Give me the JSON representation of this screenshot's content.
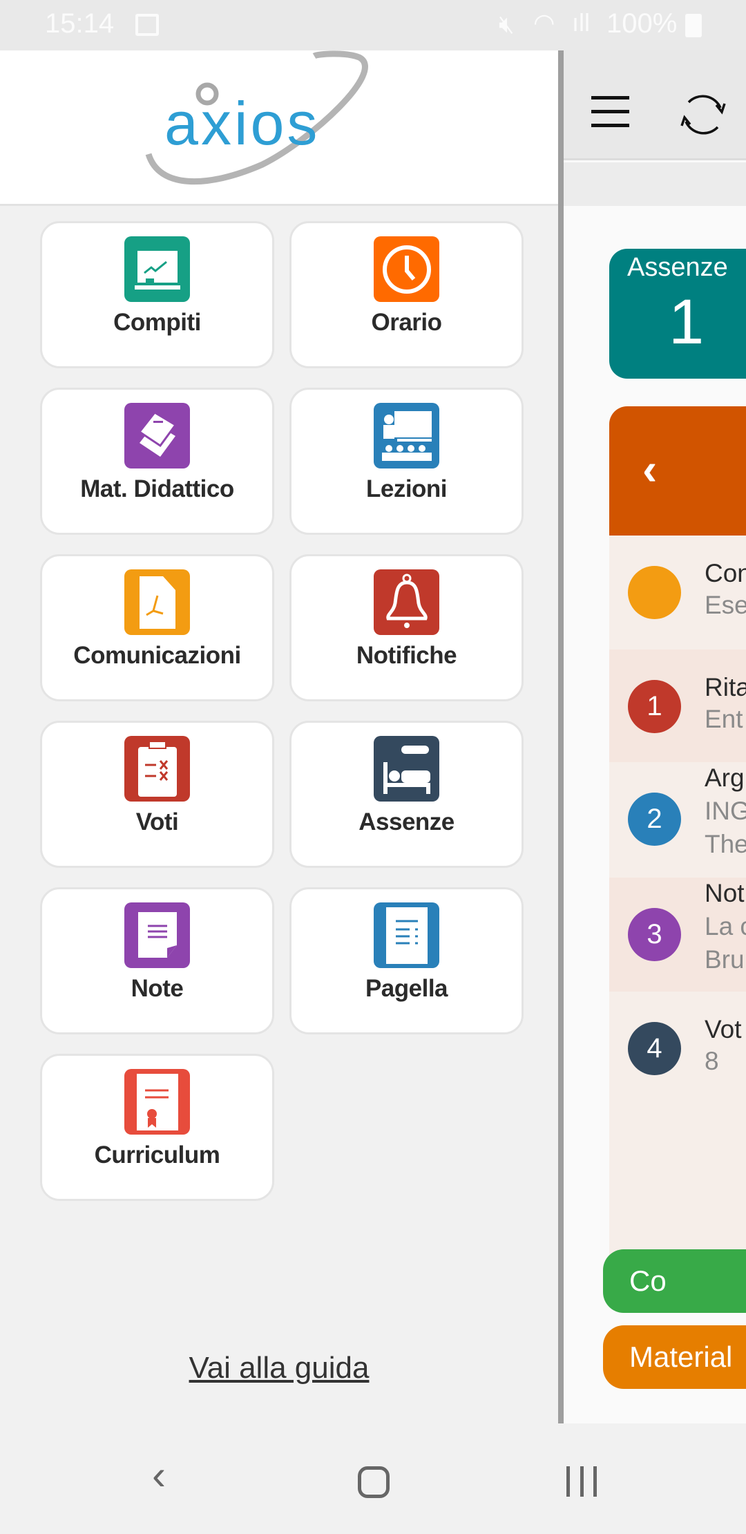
{
  "status_bar": {
    "time": "15:14",
    "battery": "100%"
  },
  "drawer": {
    "logo_text": "axios",
    "items": [
      {
        "label": "Compiti",
        "icon": "chalkboard-chart-icon",
        "color": "#16a085"
      },
      {
        "label": "Orario",
        "icon": "clock-icon",
        "color": "#ff6a00"
      },
      {
        "label": "Mat. Didattico",
        "icon": "books-icon",
        "color": "#8e44ad"
      },
      {
        "label": "Lezioni",
        "icon": "teacher-class-icon",
        "color": "#2980b9"
      },
      {
        "label": "Comunicazioni",
        "icon": "pdf-document-icon",
        "color": "#f39c12"
      },
      {
        "label": "Notifiche",
        "icon": "bell-icon",
        "color": "#c0392b"
      },
      {
        "label": "Voti",
        "icon": "clipboard-grades-icon",
        "color": "#c0392b"
      },
      {
        "label": "Assenze",
        "icon": "sick-bed-icon",
        "color": "#34495e"
      },
      {
        "label": "Note",
        "icon": "note-icon",
        "color": "#8e44ad"
      },
      {
        "label": "Pagella",
        "icon": "report-card-icon",
        "color": "#2980b9"
      },
      {
        "label": "Curriculum",
        "icon": "certificate-icon",
        "color": "#e74c3c"
      }
    ],
    "guide_link": "Vai alla guida"
  },
  "main": {
    "assenze_card": {
      "title": "Assenze",
      "value": "1",
      "color": "#008080"
    },
    "panel": {
      "header_color": "#d15400",
      "rows": [
        {
          "badge": "",
          "badge_color": "#f39c12",
          "title": "Con",
          "lines": [
            "Ese"
          ]
        },
        {
          "badge": "1",
          "badge_color": "#c0392b",
          "title": "Rita",
          "lines": [
            "Ent"
          ]
        },
        {
          "badge": "2",
          "badge_color": "#2980b9",
          "title": "Arg",
          "lines": [
            "ING",
            "The"
          ]
        },
        {
          "badge": "3",
          "badge_color": "#8e44ad",
          "title": "Not",
          "lines": [
            "La c",
            "Bru"
          ]
        },
        {
          "badge": "4",
          "badge_color": "#34495e",
          "title": "Vot",
          "lines": [
            "8"
          ]
        }
      ]
    },
    "buttons": [
      {
        "label": "Co",
        "color": "#38aa48"
      },
      {
        "label": "Material",
        "color": "#e67e00"
      }
    ]
  }
}
